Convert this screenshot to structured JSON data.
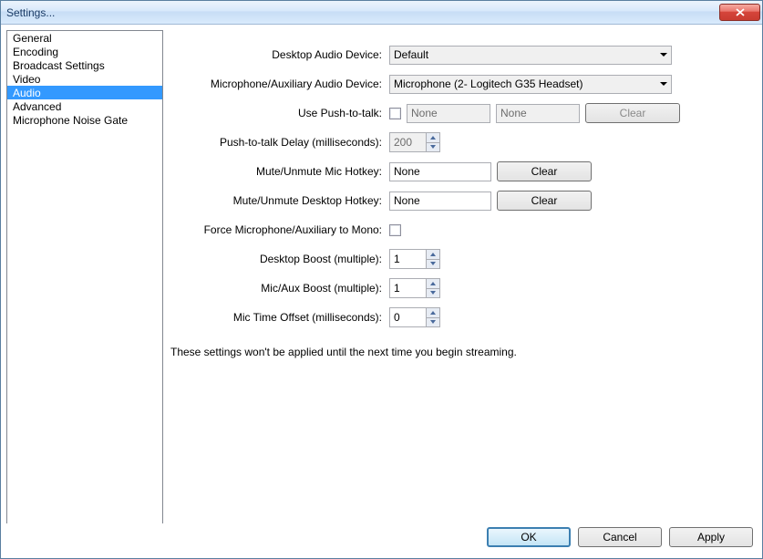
{
  "window": {
    "title": "Settings..."
  },
  "sidebar": {
    "items": [
      {
        "label": "General"
      },
      {
        "label": "Encoding"
      },
      {
        "label": "Broadcast Settings"
      },
      {
        "label": "Video"
      },
      {
        "label": "Audio",
        "selected": true
      },
      {
        "label": "Advanced"
      },
      {
        "label": "Microphone Noise Gate"
      }
    ]
  },
  "audio": {
    "desktop_device": {
      "label": "Desktop Audio Device:",
      "value": "Default"
    },
    "mic_device": {
      "label": "Microphone/Auxiliary Audio Device:",
      "value": "Microphone (2- Logitech G35 Headset)"
    },
    "ptt": {
      "label": "Use Push-to-talk:",
      "key1": "None",
      "key2": "None",
      "clear": "Clear"
    },
    "ptt_delay": {
      "label": "Push-to-talk Delay (milliseconds):",
      "value": "200"
    },
    "mute_mic_hotkey": {
      "label": "Mute/Unmute Mic Hotkey:",
      "value": "None",
      "clear": "Clear"
    },
    "mute_desk_hotkey": {
      "label": "Mute/Unmute Desktop Hotkey:",
      "value": "None",
      "clear": "Clear"
    },
    "force_mono": {
      "label": "Force Microphone/Auxiliary to Mono:"
    },
    "desktop_boost": {
      "label": "Desktop Boost (multiple):",
      "value": "1"
    },
    "mic_boost": {
      "label": "Mic/Aux Boost (multiple):",
      "value": "1"
    },
    "time_offset": {
      "label": "Mic Time Offset (milliseconds):",
      "value": "0"
    },
    "note": "These settings won't be applied until the next time you begin streaming."
  },
  "footer": {
    "ok": "OK",
    "cancel": "Cancel",
    "apply": "Apply"
  }
}
